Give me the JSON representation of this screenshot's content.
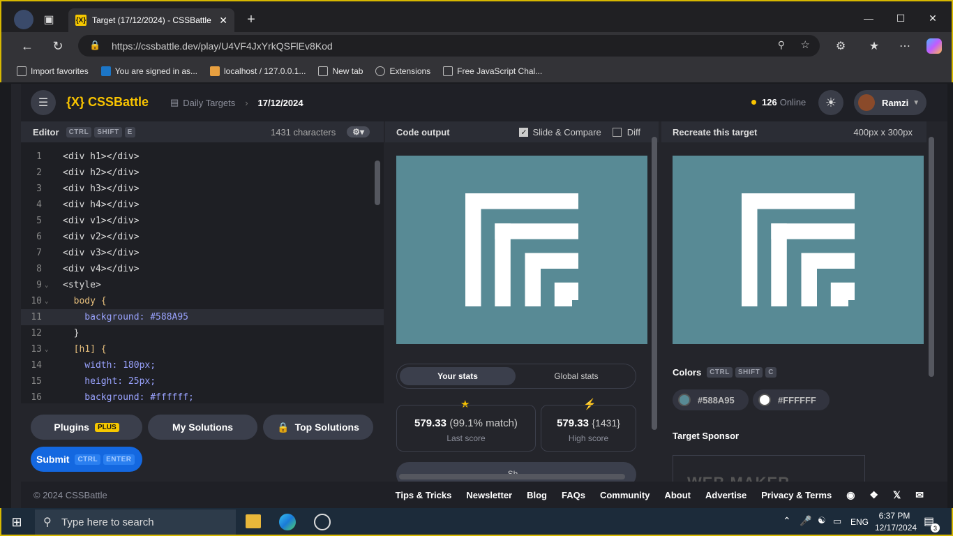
{
  "browser": {
    "tab_title": "Target (17/12/2024) - CSSBattle",
    "tab_icon": "{X}",
    "url": "https://cssbattle.dev/play/U4VF4JxYrkQSFlEv8Kod",
    "favorites": [
      "Import favorites",
      "You are signed in as...",
      "localhost / 127.0.0.1...",
      "New tab",
      "Extensions",
      "Free JavaScript Chal..."
    ]
  },
  "header": {
    "logo": "{X} CSSBattle",
    "breadcrumb_parent": "Daily Targets",
    "breadcrumb_current": "17/12/2024",
    "online_count": "126",
    "online_label": "Online",
    "user_name": "Ramzi"
  },
  "editor": {
    "title": "Editor",
    "shortcut": [
      "CTRL",
      "SHIFT",
      "E"
    ],
    "char_count": "1431 characters",
    "lines": [
      {
        "n": "1",
        "code": "<div h1></div>"
      },
      {
        "n": "2",
        "code": "<div h2></div>"
      },
      {
        "n": "3",
        "code": "<div h3></div>"
      },
      {
        "n": "4",
        "code": "<div h4></div>"
      },
      {
        "n": "5",
        "code": "<div v1></div>"
      },
      {
        "n": "6",
        "code": "<div v2></div>"
      },
      {
        "n": "7",
        "code": "<div v3></div>"
      },
      {
        "n": "8",
        "code": "<div v4></div>"
      },
      {
        "n": "9",
        "code": "<style>"
      },
      {
        "n": "10",
        "code": "  body {"
      },
      {
        "n": "11",
        "code": "    background: #588A95"
      },
      {
        "n": "12",
        "code": "  }"
      },
      {
        "n": "13",
        "code": "  [h1] {"
      },
      {
        "n": "14",
        "code": "    width: 180px;"
      },
      {
        "n": "15",
        "code": "    height: 25px;"
      },
      {
        "n": "16",
        "code": "    background: #ffffff;"
      }
    ]
  },
  "buttons": {
    "plugins": "Plugins",
    "plugins_badge": "PLUS",
    "my_solutions": "My Solutions",
    "top_solutions": "Top Solutions",
    "submit": "Submit",
    "submit_keys": [
      "CTRL",
      "ENTER"
    ]
  },
  "output": {
    "title": "Code output",
    "slide_compare": "Slide & Compare",
    "slide_compare_checked": true,
    "diff": "Diff",
    "diff_checked": false,
    "tab_your": "Your stats",
    "tab_global": "Global stats",
    "last_score_value": "579.33",
    "last_score_match": "(99.1% match)",
    "last_score_label": "Last score",
    "high_score_value": "579.33",
    "high_score_chars": "{1431}",
    "high_score_label": "High score",
    "bottom_button_partial": "Sh..."
  },
  "target": {
    "title": "Recreate this target",
    "size": "400px x 300px",
    "colors_label": "Colors",
    "colors_keys": [
      "CTRL",
      "SHIFT",
      "C"
    ],
    "colors": [
      {
        "label": "#588A95",
        "hex": "#588A95"
      },
      {
        "label": "#FFFFFF",
        "hex": "#FFFFFF"
      }
    ],
    "sponsor_label": "Target Sponsor",
    "sponsor_text": "WEB MAKER"
  },
  "footer": {
    "copyright": "© 2024 CSSBattle",
    "links": [
      "Tips & Tricks",
      "Newsletter",
      "Blog",
      "FAQs",
      "Community",
      "About",
      "Advertise",
      "Privacy & Terms"
    ]
  },
  "taskbar": {
    "search_placeholder": "Type here to search",
    "lang": "ENG",
    "time": "6:37 PM",
    "date": "12/17/2024",
    "notif_count": "3"
  }
}
